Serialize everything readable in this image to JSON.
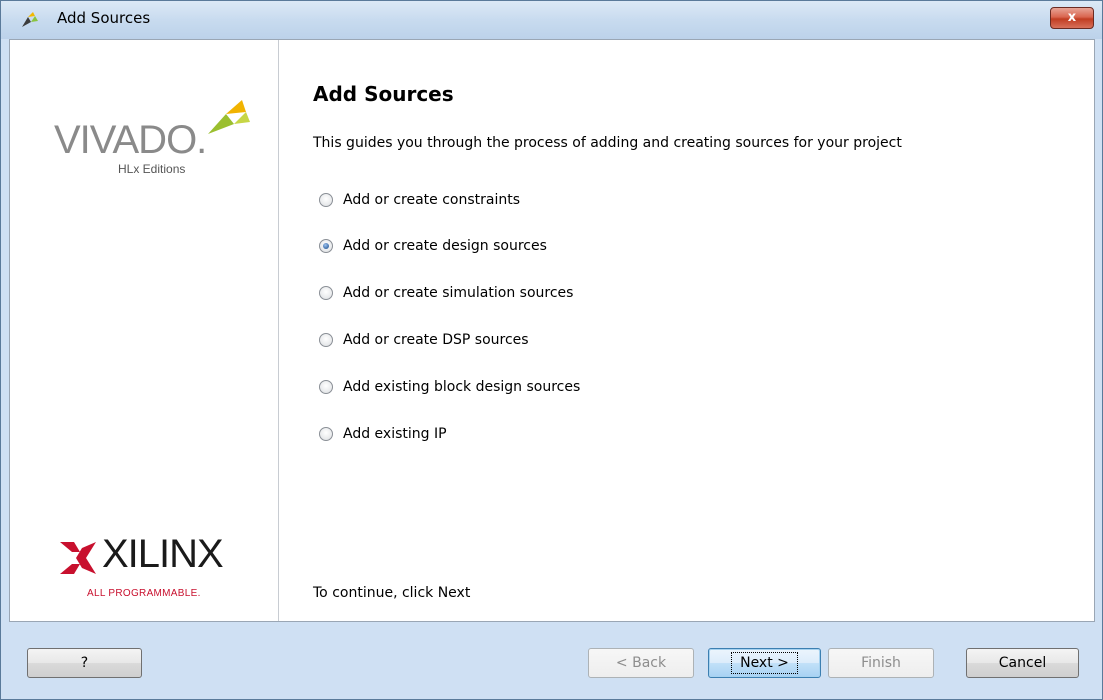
{
  "window": {
    "title": "Add Sources",
    "close_label": "x"
  },
  "sidebar": {
    "vivado_logo_text": "VIVADO.",
    "vivado_sub_text": "HLx Editions",
    "xilinx_logo_text": "XILINX",
    "xilinx_sub_text": "ALL PROGRAMMABLE."
  },
  "content": {
    "heading": "Add Sources",
    "description": "This guides you through the process of adding and creating sources for your project",
    "options": [
      {
        "label": "Add or create constraints",
        "checked": false
      },
      {
        "label": "Add or create design sources",
        "checked": true
      },
      {
        "label": "Add or create simulation sources",
        "checked": false
      },
      {
        "label": "Add or create DSP sources",
        "checked": false
      },
      {
        "label": "Add existing block design sources",
        "checked": false
      },
      {
        "label": "Add existing IP",
        "checked": false
      }
    ],
    "footer": "To continue, click Next"
  },
  "buttons": {
    "help": "?",
    "back": "< Back",
    "next": "Next >",
    "finish": "Finish",
    "cancel": "Cancel"
  }
}
